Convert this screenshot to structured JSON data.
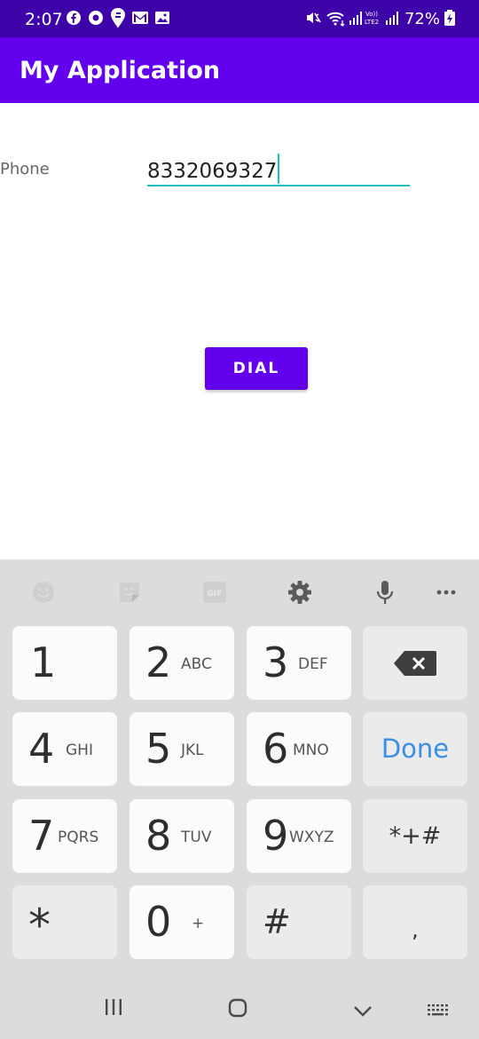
{
  "status_bar": {
    "time": "2:07",
    "battery": "72%",
    "icons": [
      "facebook-icon",
      "circle-app-icon",
      "swiggy-icon",
      "gmail-icon",
      "gallery-icon",
      "mute-icon",
      "wifi-icon",
      "signal-icon",
      "volte-lte2-icon",
      "signal-icon",
      "battery-icon"
    ],
    "network_label": "Vo))\nLTE2"
  },
  "app_bar": {
    "title": "My Application"
  },
  "form": {
    "phone_label": "Phone",
    "phone_value": "8332069327",
    "dial_label": "DIAL"
  },
  "keyboard": {
    "toolbar": [
      "emoji-icon",
      "sticker-icon",
      "gif-icon",
      "settings-icon",
      "microphone-icon",
      "more-icon"
    ],
    "gif_label": "GIF",
    "keys": {
      "k1": {
        "digit": "1",
        "letters": ""
      },
      "k2": {
        "digit": "2",
        "letters": "ABC"
      },
      "k3": {
        "digit": "3",
        "letters": "DEF"
      },
      "k4": {
        "digit": "4",
        "letters": "GHI"
      },
      "k5": {
        "digit": "5",
        "letters": "JKL"
      },
      "k6": {
        "digit": "6",
        "letters": "MNO"
      },
      "k7": {
        "digit": "7",
        "letters": "PQRS"
      },
      "k8": {
        "digit": "8",
        "letters": "TUV"
      },
      "k9": {
        "digit": "9",
        "letters": "WXYZ"
      },
      "k0": {
        "digit": "0",
        "letters": "+"
      },
      "star": "*",
      "hash": "#",
      "comma": ",",
      "done": "Done",
      "symbols": "*+#"
    }
  },
  "nav_bar": {
    "icons": [
      "recents-icon",
      "home-icon",
      "back-icon",
      "keyboard-switch-icon"
    ]
  },
  "colors": {
    "primary": "#6200ee",
    "primary_dark": "#3d03a9",
    "accent": "#19c3c0",
    "done_blue": "#3a8ee6"
  }
}
